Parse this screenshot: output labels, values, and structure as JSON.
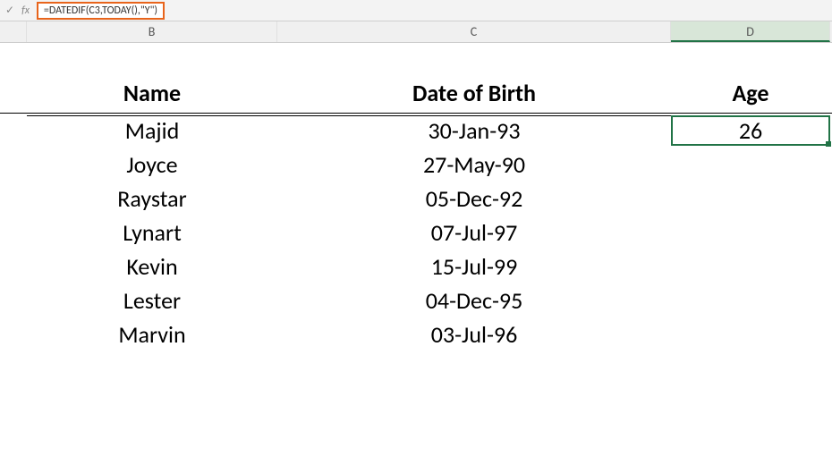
{
  "formula_bar": {
    "fx_label": "fx",
    "formula": "=DATEDIF(C3,TODAY(),\"Y\")"
  },
  "columns": {
    "b": "B",
    "c": "C",
    "d": "D"
  },
  "headers": {
    "name": "Name",
    "dob": "Date of Birth",
    "age": "Age"
  },
  "rows": [
    {
      "name": "Majid",
      "dob": "30-Jan-93",
      "age": "26"
    },
    {
      "name": "Joyce",
      "dob": "27-May-90",
      "age": ""
    },
    {
      "name": "Raystar",
      "dob": "05-Dec-92",
      "age": ""
    },
    {
      "name": "Lynart",
      "dob": "07-Jul-97",
      "age": ""
    },
    {
      "name": "Kevin",
      "dob": "15-Jul-99",
      "age": ""
    },
    {
      "name": "Lester",
      "dob": "04-Dec-95",
      "age": ""
    },
    {
      "name": "Marvin",
      "dob": "03-Jul-96",
      "age": ""
    }
  ],
  "active_cell_index": 0
}
